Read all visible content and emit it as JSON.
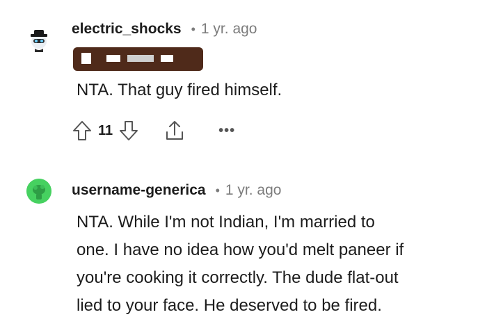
{
  "comments": [
    {
      "username": "electric_shocks",
      "separator": "•",
      "time": "1 yr. ago",
      "body": "NTA. That guy fired himself.",
      "score": "11",
      "more": "•••",
      "icons": {
        "avatar": "snoo-avatar-icon",
        "upvote": "upvote-arrow-icon",
        "downvote": "downvote-arrow-icon",
        "share": "share-icon",
        "more": "more-options-icon"
      }
    },
    {
      "username": "username-generica",
      "separator": "•",
      "time": "1 yr. ago",
      "body_lines": [
        "NTA. While I'm not Indian, I'm married to",
        "one. I have no idea how you'd melt paneer if",
        "you're cooking it correctly. The dude flat-out",
        "lied to your face. He deserved to be fired."
      ],
      "icons": {
        "avatar": "green-avatar-icon"
      }
    }
  ],
  "colors": {
    "flair_bg": "#4f2a1a",
    "avatar_green": "#46d160",
    "muted_text": "#7c7c7c"
  }
}
